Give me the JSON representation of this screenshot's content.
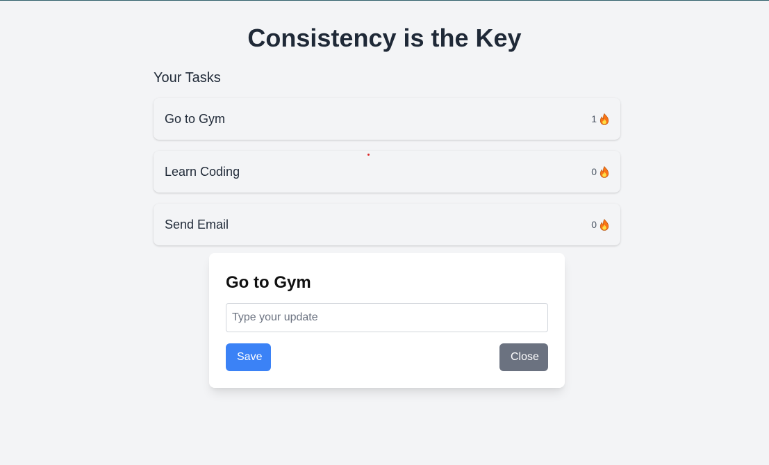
{
  "page": {
    "title": "Consistency is the Key",
    "tasks_heading": "Your Tasks"
  },
  "tasks": [
    {
      "name": "Go to Gym",
      "streak": "1",
      "icon": "fire-icon"
    },
    {
      "name": "Learn Coding",
      "streak": "0",
      "icon": "fire-icon"
    },
    {
      "name": "Send Email",
      "streak": "0",
      "icon": "fire-icon"
    }
  ],
  "modal": {
    "title": "Go to Gym",
    "input_value": "",
    "input_placeholder": "Type your update",
    "save_label": "Save",
    "close_label": "Close"
  },
  "colors": {
    "background": "#f3f4f6",
    "primary": "#3b82f6",
    "secondary": "#6b7280",
    "text": "#1f2937"
  }
}
